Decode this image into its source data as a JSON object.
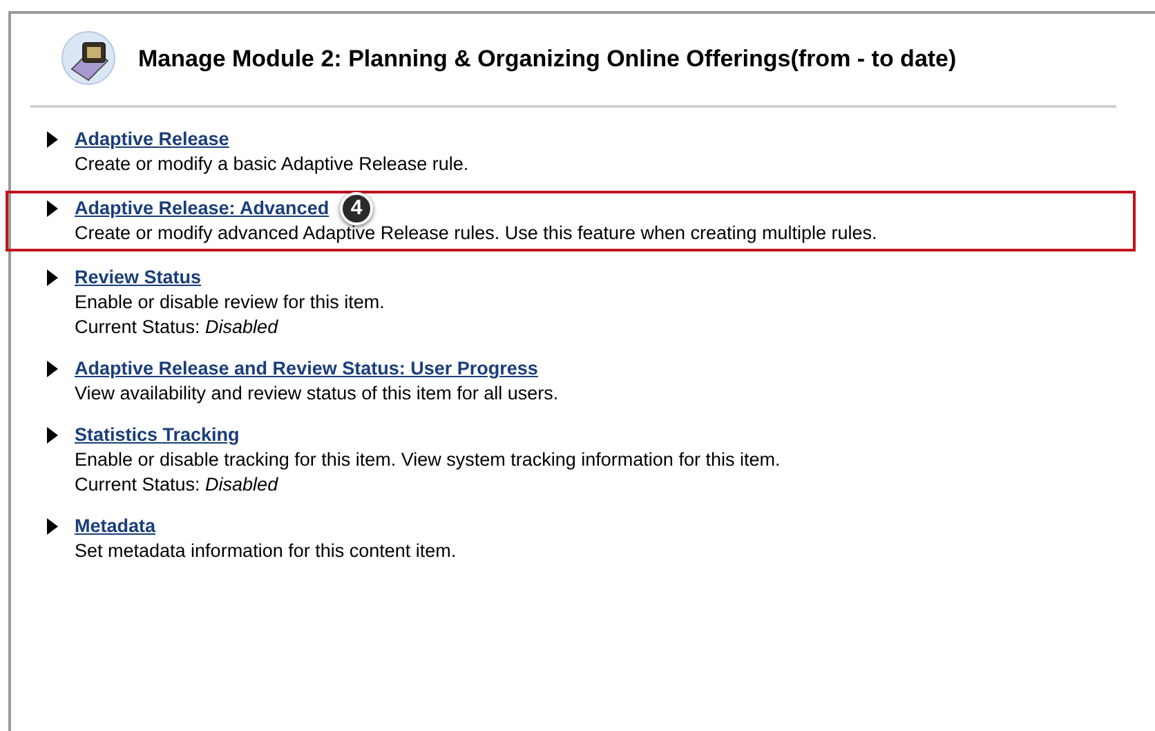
{
  "page": {
    "title": "Manage Module 2: Planning & Organizing Online Offerings(from - to date)"
  },
  "items": [
    {
      "link": "Adaptive Release",
      "description": "Create or modify a basic Adaptive Release rule.",
      "highlighted": false
    },
    {
      "link": "Adaptive Release: Advanced",
      "description": "Create or modify advanced Adaptive Release rules. Use this feature when creating multiple rules.",
      "highlighted": true,
      "callout": "4"
    },
    {
      "link": "Review Status",
      "description": "Enable or disable review for this item.",
      "status": "Current Status: *Disabled*",
      "highlighted": false
    },
    {
      "link": "Adaptive Release and Review Status: User Progress",
      "description": "View availability and review status of this item for all users.",
      "highlighted": false
    },
    {
      "link": "Statistics Tracking",
      "description": "Enable or disable tracking for this item. View system tracking information for this item.",
      "status": "Current Status: *Disabled*",
      "highlighted": false
    },
    {
      "link": "Metadata",
      "description": "Set metadata information for this content item.",
      "highlighted": false
    }
  ]
}
